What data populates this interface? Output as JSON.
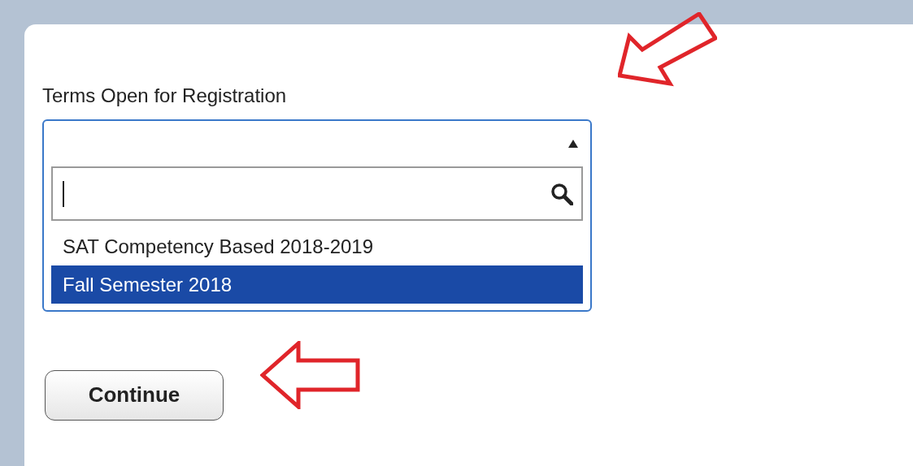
{
  "field_label": "Terms Open for Registration",
  "dropdown": {
    "expanded": true,
    "options": [
      {
        "label": "SAT Competency Based 2018-2019",
        "selected": false
      },
      {
        "label": "Fall Semester 2018",
        "selected": true
      }
    ]
  },
  "buttons": [
    "Continue"
  ]
}
